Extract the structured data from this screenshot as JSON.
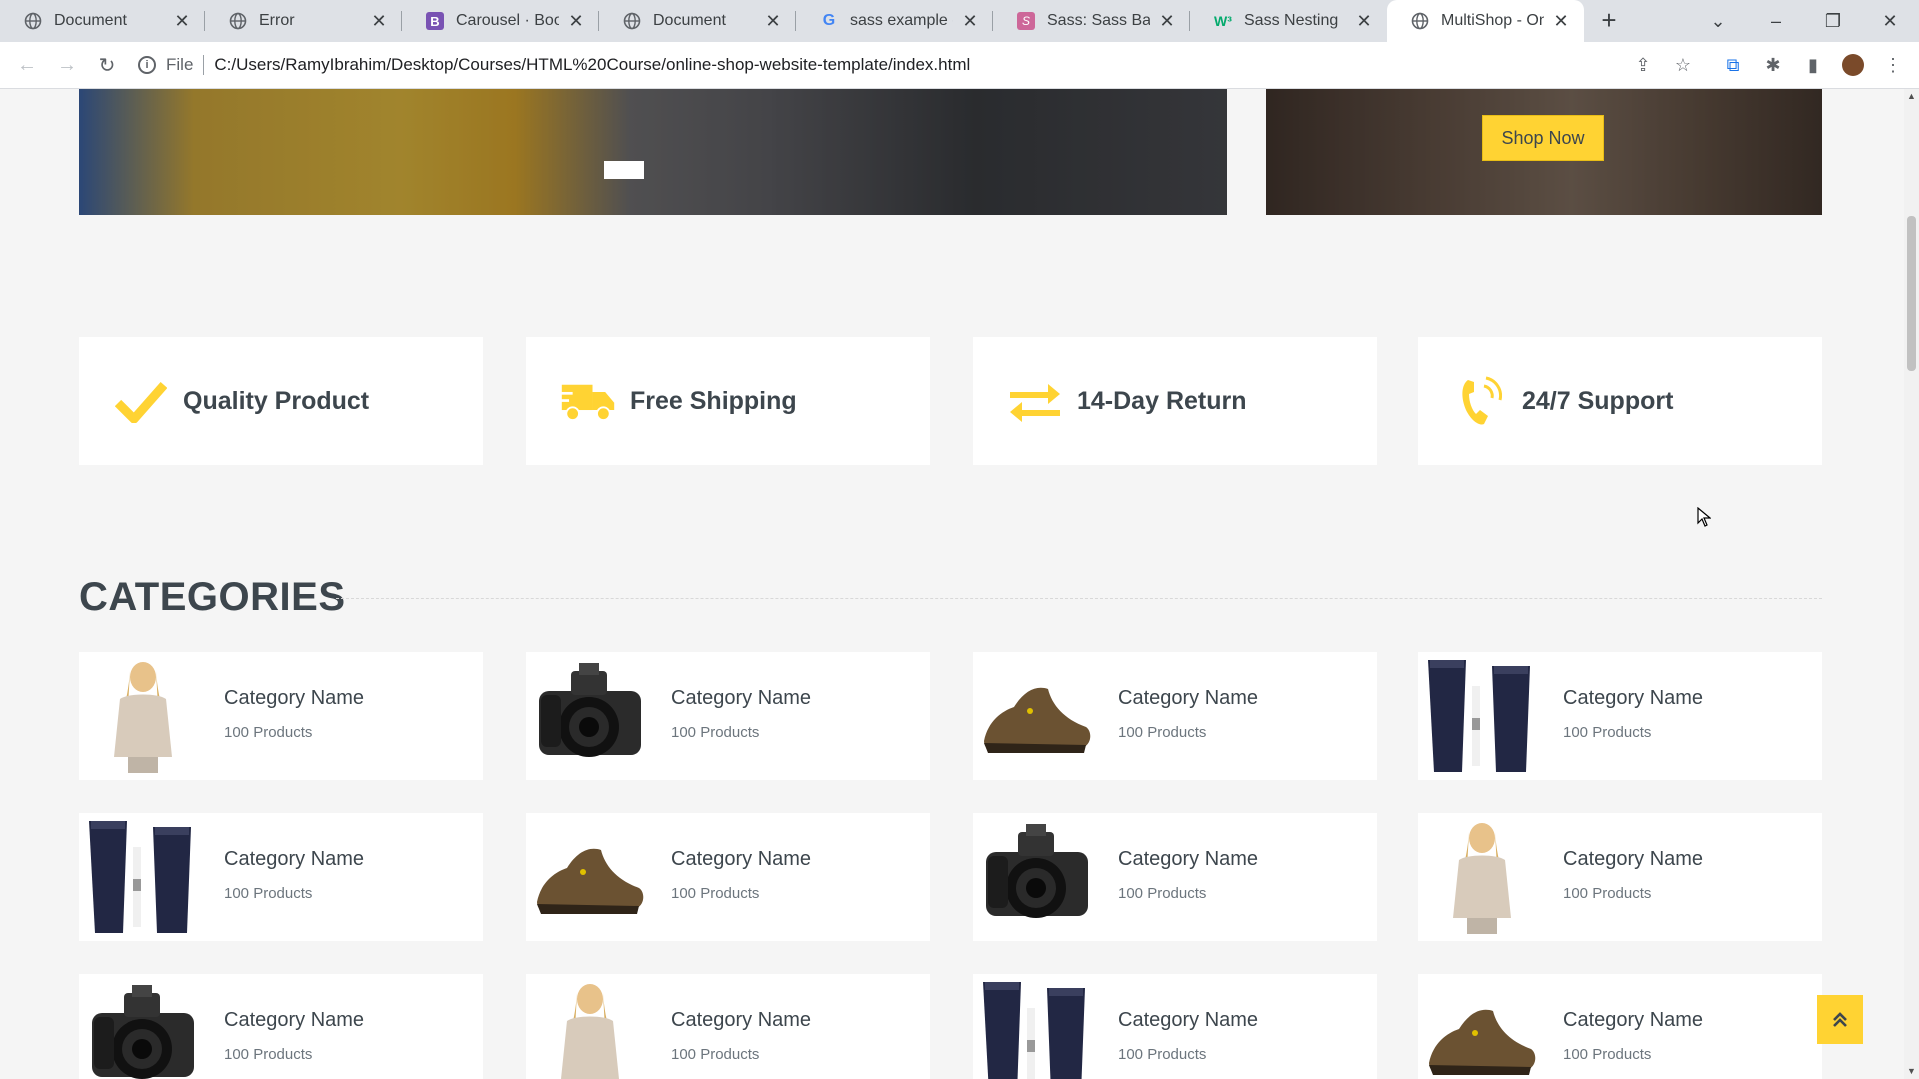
{
  "browser": {
    "tabs": [
      {
        "title": "Document",
        "icon": "globe-icon",
        "active": false
      },
      {
        "title": "Error",
        "icon": "globe-icon",
        "active": false
      },
      {
        "title": "Carousel · Bootst",
        "icon": "bootstrap-icon",
        "active": false
      },
      {
        "title": "Document",
        "icon": "globe-icon",
        "active": false
      },
      {
        "title": "sass example - G",
        "icon": "google-icon",
        "active": false
      },
      {
        "title": "Sass: Sass Basics",
        "icon": "sass-icon",
        "active": false
      },
      {
        "title": "Sass Nesting",
        "icon": "w3schools-icon",
        "active": false
      },
      {
        "title": "MultiShop - Onli",
        "icon": "globe-icon",
        "active": true
      }
    ],
    "address": {
      "scheme": "File",
      "url": "C:/Users/RamyIbrahim/Desktop/Courses/HTML%20Course/online-shop-website-template/index.html"
    }
  },
  "hero": {
    "shop_now": "Shop Now"
  },
  "features": [
    {
      "icon": "check-icon",
      "label": "Quality Product"
    },
    {
      "icon": "truck-icon",
      "label": "Free Shipping"
    },
    {
      "icon": "exchange-icon",
      "label": "14-Day Return"
    },
    {
      "icon": "phone-volume-icon",
      "label": "24/7 Support"
    }
  ],
  "categories": {
    "title": "CATEGORIES",
    "items": [
      {
        "name": "Category Name",
        "count": "100 Products",
        "image": "woman-image"
      },
      {
        "name": "Category Name",
        "count": "100 Products",
        "image": "camera-image"
      },
      {
        "name": "Category Name",
        "count": "100 Products",
        "image": "shoe-image"
      },
      {
        "name": "Category Name",
        "count": "100 Products",
        "image": "cosmetics-image"
      },
      {
        "name": "Category Name",
        "count": "100 Products",
        "image": "cosmetics-image"
      },
      {
        "name": "Category Name",
        "count": "100 Products",
        "image": "shoe-image"
      },
      {
        "name": "Category Name",
        "count": "100 Products",
        "image": "camera-image"
      },
      {
        "name": "Category Name",
        "count": "100 Products",
        "image": "woman-image"
      },
      {
        "name": "Category Name",
        "count": "100 Products",
        "image": "camera-image"
      },
      {
        "name": "Category Name",
        "count": "100 Products",
        "image": "woman-image"
      },
      {
        "name": "Category Name",
        "count": "100 Products",
        "image": "cosmetics-image"
      },
      {
        "name": "Category Name",
        "count": "100 Products",
        "image": "shoe-image"
      }
    ]
  },
  "colors": {
    "accent": "#ffd333",
    "text": "#3d464d",
    "background": "#f5f5f5"
  }
}
